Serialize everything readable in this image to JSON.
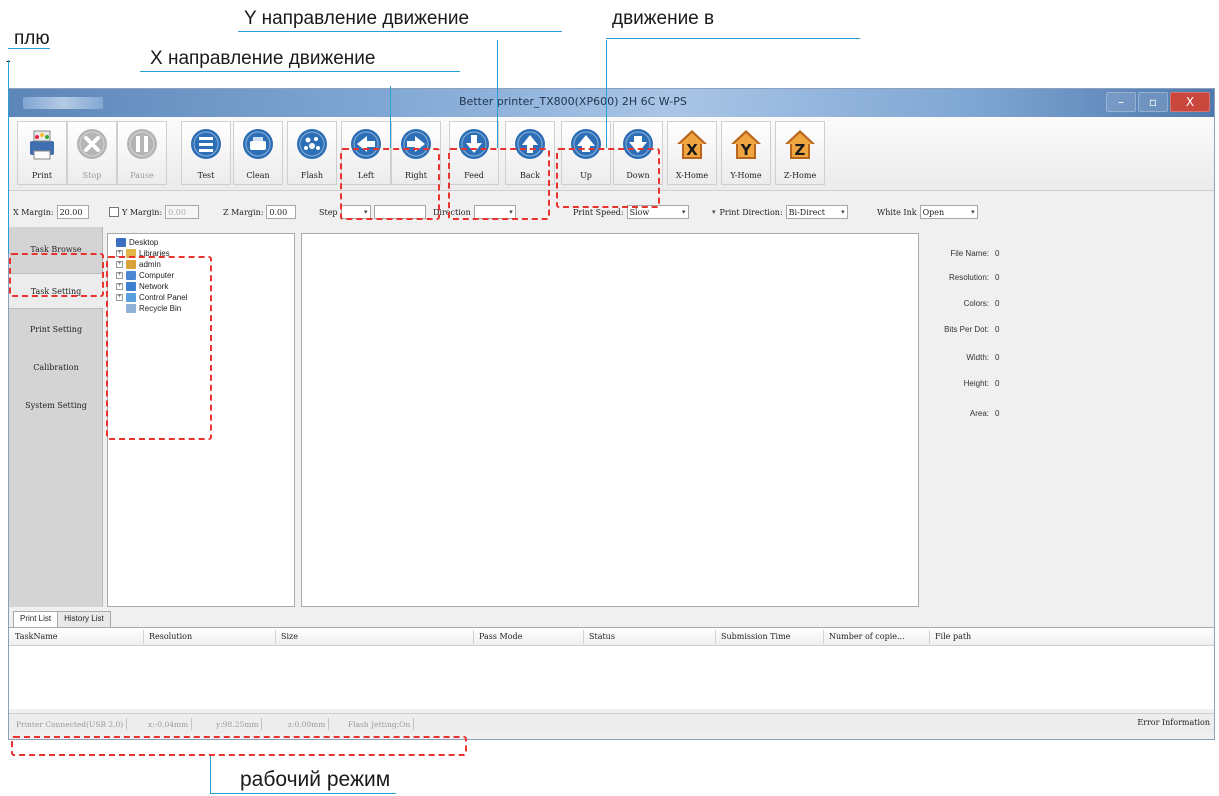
{
  "annotations": {
    "plus": "плю",
    "dash": "-",
    "x_direction": "X  направление  движение",
    "y_direction": "Y  направление  движение",
    "motion_in": "движение в",
    "work_mode": "рабочий режим"
  },
  "window": {
    "title": "Better printer_TX800(XP600) 2H 6C W-PS",
    "minimize": "–",
    "maximize": "▫",
    "close": "X"
  },
  "toolbar": [
    {
      "id": "print",
      "label": "Print",
      "icon": "printer-icon",
      "enabled": true
    },
    {
      "id": "stop",
      "label": "Stop",
      "icon": "stop-icon",
      "enabled": false
    },
    {
      "id": "pause",
      "label": "Pause",
      "icon": "pause-icon",
      "enabled": false
    },
    {
      "id": "test",
      "label": "Test",
      "icon": "test-icon",
      "enabled": true
    },
    {
      "id": "clean",
      "label": "Clean",
      "icon": "clean-icon",
      "enabled": true
    },
    {
      "id": "flash",
      "label": "Flash",
      "icon": "flash-icon",
      "enabled": true
    },
    {
      "id": "left",
      "label": "Left",
      "icon": "arrow-left-icon",
      "enabled": true
    },
    {
      "id": "right",
      "label": "Right",
      "icon": "arrow-right-icon",
      "enabled": true
    },
    {
      "id": "feed",
      "label": "Feed",
      "icon": "arrow-down-icon",
      "enabled": true
    },
    {
      "id": "back",
      "label": "Back",
      "icon": "arrow-up-icon",
      "enabled": true
    },
    {
      "id": "up",
      "label": "Up",
      "icon": "up-icon",
      "enabled": true
    },
    {
      "id": "down",
      "label": "Down",
      "icon": "down-icon",
      "enabled": true
    },
    {
      "id": "xhome",
      "label": "X-Home",
      "letter": "X",
      "icon": "x-home-icon",
      "enabled": true
    },
    {
      "id": "yhome",
      "label": "Y-Home",
      "letter": "Y",
      "icon": "y-home-icon",
      "enabled": true
    },
    {
      "id": "zhome",
      "label": "Z-Home",
      "letter": "Z",
      "icon": "z-home-icon",
      "enabled": true
    }
  ],
  "marginbar": {
    "x_margin_label": "X Margin:",
    "x_margin_value": "20.00",
    "y_margin_label": "Y Margin:",
    "y_margin_value": "0.00",
    "z_margin_label": "Z Margin:",
    "z_margin_value": "0.00",
    "step_label": "Step",
    "step_value": "",
    "direction_label": "Direction",
    "direction_value": "",
    "print_speed_label": "Print Speed:",
    "print_speed_value": "Slow",
    "print_direction_label": "Print Direction:",
    "print_direction_value": "Bi-Direct",
    "white_ink_label": "White Ink",
    "white_ink_value": "Open"
  },
  "nav": [
    {
      "label": "Task Browse",
      "active": false
    },
    {
      "label": "Task Setting",
      "active": true
    },
    {
      "label": "Print Setting",
      "active": false
    },
    {
      "label": "Calibration",
      "active": false
    },
    {
      "label": "System Setting",
      "active": false
    }
  ],
  "tree": [
    {
      "label": "Desktop",
      "level": 0,
      "expander": "",
      "color": "#3a6fc2"
    },
    {
      "label": "Libraries",
      "level": 1,
      "expander": "+",
      "color": "#e0b64a"
    },
    {
      "label": "admin",
      "level": 1,
      "expander": "+",
      "color": "#d8a43a"
    },
    {
      "label": "Computer",
      "level": 1,
      "expander": "+",
      "color": "#4a86d1"
    },
    {
      "label": "Network",
      "level": 1,
      "expander": "+",
      "color": "#3f7fcf"
    },
    {
      "label": "Control Panel",
      "level": 1,
      "expander": "+",
      "color": "#5aa0de"
    },
    {
      "label": "Recycle Bin",
      "level": 1,
      "expander": "",
      "color": "#8fb0d6"
    }
  ],
  "info": [
    {
      "label": "File Name:",
      "value": "0"
    },
    {
      "label": "Resolution:",
      "value": "0"
    },
    {
      "label": "Colors:",
      "value": "0"
    },
    {
      "label": "Bits Per Dot:",
      "value": "0"
    },
    {
      "label": "Width:",
      "value": "0"
    },
    {
      "label": "Height:",
      "value": "0"
    },
    {
      "label": "Area:",
      "value": "0"
    }
  ],
  "list_tabs": [
    "Print List",
    "History List"
  ],
  "list_columns": [
    "TaskName",
    "Resolution",
    "Size",
    "Pass Mode",
    "Status",
    "Submission Time",
    "Number of copie...",
    "File path"
  ],
  "statusbar": {
    "segments": [
      "Printer Connected(USB 2.0)",
      "x:-0.04mm",
      "y:98.25mm",
      "z:0.00mm",
      "Flash Jetting:On"
    ],
    "right": "Error Information"
  }
}
